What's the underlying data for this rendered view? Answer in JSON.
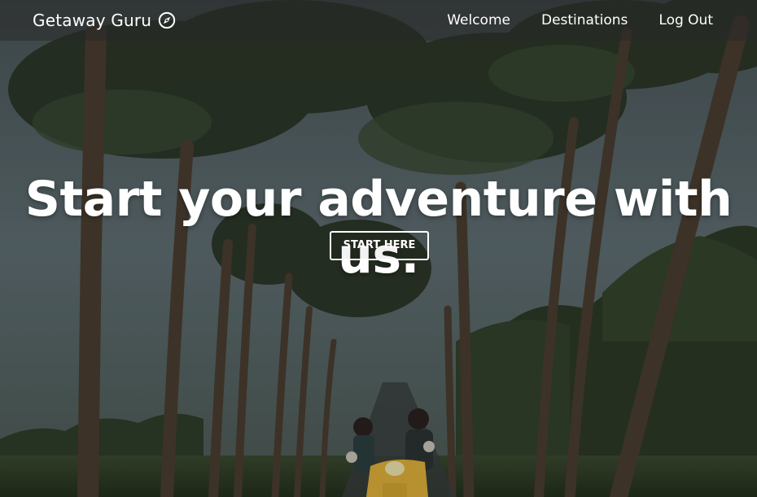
{
  "navbar": {
    "brand": "Getaway Guru",
    "brand_icon": "compass-icon",
    "links": [
      "Welcome",
      "Destinations",
      "Log Out"
    ]
  },
  "hero": {
    "headline": "Start your adventure with us.",
    "cta_label": "START HERE",
    "background": "Couple riding a yellow scooter down a road lined with tall palm trees"
  },
  "colors": {
    "text": "#ffffff",
    "navbar_bg": "rgba(40,40,40,0.55)",
    "scooter": "#e0b13a"
  }
}
